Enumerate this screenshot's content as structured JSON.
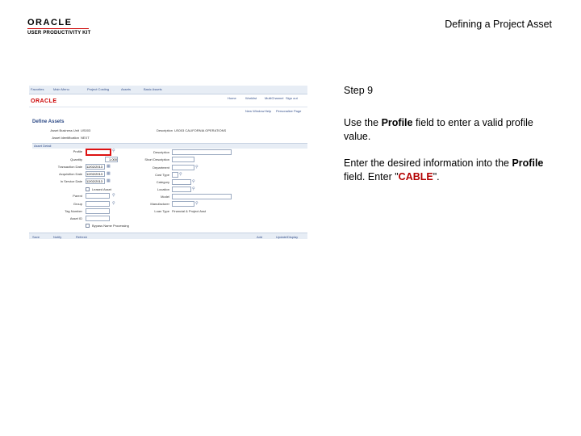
{
  "header": {
    "logo_line1": "ORACLE",
    "logo_line2": "USER PRODUCTIVITY KIT",
    "title": "Defining a Project Asset"
  },
  "screenshot": {
    "nav": [
      "Favorites",
      "Main Menu",
      "Project Costing",
      "Assets",
      "Basic Assets"
    ],
    "top_links": [
      "Home",
      "Worklist",
      "MultiChannel",
      "Add to Favorites",
      "Sign out"
    ],
    "brand": "ORACLE",
    "sub_links": [
      "New Window",
      "Help",
      "Personalize Page"
    ],
    "page_heading": "Define Assets",
    "business_unit_label": "Asset Business Unit",
    "business_unit_value": "US003",
    "description_label": "Description",
    "description_value": "US003 CALIFORNIA OPERATIONS",
    "asset_id_label": "Asset Identification",
    "asset_id_value": "NEXT",
    "section": "Asset Detail",
    "left_fields": [
      "Profile",
      "Quantity",
      "Transaction Date",
      "Acquisition Date",
      "In Service Date"
    ],
    "quantity_value": "1.000",
    "date_values": [
      "12/02/2013",
      "12/02/2013",
      "12/02/2013"
    ],
    "right_fields": [
      "Description",
      "Short Description",
      "Department",
      "Cost Type",
      "Category",
      "Location"
    ],
    "leased_label": "Leased Asset",
    "parent_label": "Parent",
    "group_label": "Group",
    "tag_label": "Tag Number",
    "asset_number_label": "Asset ID",
    "model_label": "Model",
    "manufacturer_label": "Manufacturer",
    "loan_type_label": "Loan Type",
    "loan_type_value": "Financial & Project Asst",
    "bypass_label": "Bypass Name Processing",
    "footer_left": [
      "Save",
      "Notify",
      "Refresh"
    ],
    "footer_right": [
      "Add",
      "Update/Display"
    ]
  },
  "instructions": {
    "step": "Step 9",
    "line1_pre": "Use the ",
    "line1_bold": "Profile",
    "line1_post": " field to enter a valid profile value.",
    "line2_pre": "Enter the desired information into the ",
    "line2_bold": "Profile",
    "line2_mid": " field. Enter \"",
    "line2_value": "CABLE",
    "line2_post": "\"."
  },
  "colors": {
    "highlight": "#d11111",
    "brand_red": "#c00000",
    "ps_link": "#36518c"
  }
}
